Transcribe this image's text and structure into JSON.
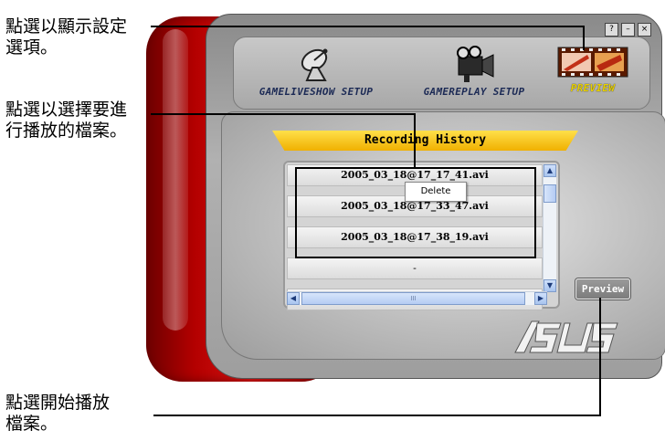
{
  "callouts": {
    "settings_tip": "點選以顯示設定\n選項。",
    "select_file_tip": "點選以選擇要進\n行播放的檔案。",
    "play_tip": "點選開始播放\n檔案。"
  },
  "window_controls": {
    "help": "?",
    "minimize": "–",
    "close": "×"
  },
  "menu": {
    "gameliveshow": "GAMELIVESHOW SETUP",
    "gamereplay": "GAMEREPLAY SETUP",
    "preview": "PREVIEW"
  },
  "icons": {
    "gameliveshow": "satellite-dish-icon",
    "gamereplay": "video-camera-icon",
    "preview": "film-strip-icon"
  },
  "history": {
    "title": "Recording History",
    "rows": [
      "2005_03_18@17_17_41.avi",
      "2005_03_18@17_33_47.avi",
      "2005_03_18@17_38_19.avi",
      "-",
      "-"
    ],
    "context_menu_item": "Delete",
    "hscroll_grip": "III"
  },
  "preview_button": "Preview",
  "logo": "/ISUS",
  "colors": {
    "frame_red": "#c00000",
    "title_bar": "#f5c400",
    "active_menu": "#e8d000"
  }
}
